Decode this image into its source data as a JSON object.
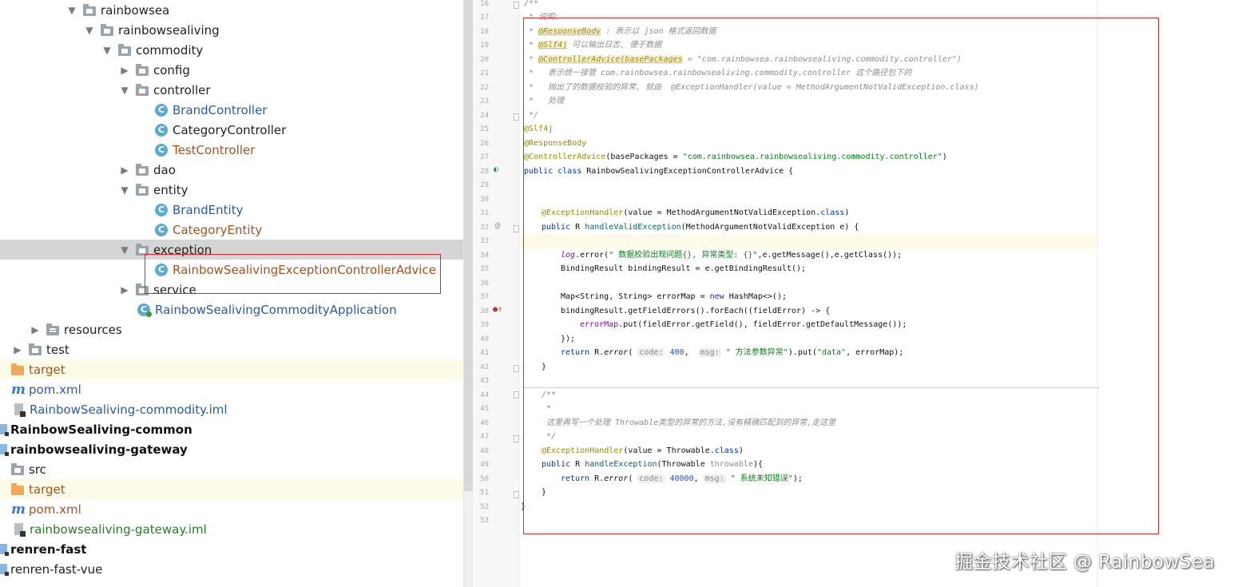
{
  "tree": {
    "items": [
      {
        "label": "rainbowsea",
        "type": "folder",
        "expanded": true
      },
      {
        "label": "rainbowsealiving",
        "type": "folder",
        "expanded": true
      },
      {
        "label": "commodity",
        "type": "folder",
        "expanded": true
      },
      {
        "label": "config",
        "type": "folder",
        "expanded": false
      },
      {
        "label": "controller",
        "type": "folder",
        "expanded": true
      },
      {
        "label": "BrandController",
        "type": "class"
      },
      {
        "label": "CategoryController",
        "type": "class"
      },
      {
        "label": "TestController",
        "type": "class"
      },
      {
        "label": "dao",
        "type": "folder",
        "expanded": false
      },
      {
        "label": "entity",
        "type": "folder",
        "expanded": true
      },
      {
        "label": "BrandEntity",
        "type": "class"
      },
      {
        "label": "CategoryEntity",
        "type": "class"
      },
      {
        "label": "exception",
        "type": "folder",
        "expanded": true
      },
      {
        "label": "RainbowSealivingExceptionControllerAdvice",
        "type": "class"
      },
      {
        "label": "service",
        "type": "folder",
        "expanded": false
      },
      {
        "label": "RainbowSealivingCommodityApplication",
        "type": "app-class"
      },
      {
        "label": "resources",
        "type": "folder",
        "expanded": false
      },
      {
        "label": "test",
        "type": "folder",
        "expanded": false
      },
      {
        "label": "target",
        "type": "folder"
      },
      {
        "label": "pom.xml",
        "type": "maven"
      },
      {
        "label": "RainbowSealiving-commodity.iml",
        "type": "iml"
      },
      {
        "label": "RainbowSealiving-common",
        "type": "module"
      },
      {
        "label": "rainbowsealiving-gateway",
        "type": "module"
      },
      {
        "label": "src",
        "type": "folder"
      },
      {
        "label": "target",
        "type": "folder"
      },
      {
        "label": "pom.xml",
        "type": "maven"
      },
      {
        "label": "rainbowsealiving-gateway.iml",
        "type": "iml"
      },
      {
        "label": "renren-fast",
        "type": "module"
      },
      {
        "label": "renren-fast-vue",
        "type": "module"
      }
    ]
  },
  "editor": {
    "line_numbers": [
      "16",
      "17",
      "18",
      "19",
      "20",
      "21",
      "22",
      "23",
      "24",
      "25",
      "26",
      "27",
      "28",
      "29",
      "30",
      "31",
      "32",
      "33",
      "34",
      "35",
      "36",
      "37",
      "38",
      "39",
      "40",
      "41",
      "42",
      "43",
      "44",
      "45",
      "46",
      "47",
      "48",
      "49",
      "50",
      "51",
      "52",
      "53"
    ],
    "code": {
      "l16": "/**",
      "l17_a": " * ",
      "l17_b": "说明:",
      "l18_a": " * ",
      "l18_b": "@ResponseBody",
      "l18_c": " : 表示以 json 格式返回数据",
      "l19_a": " * ",
      "l19_b": "@Slf4j",
      "l19_c": " 可以输出日志, 便于数据",
      "l20_a": " * ",
      "l20_b": "@ControllerAdvice(basePackages",
      "l20_c": " = \"com.rainbowsea.rainbowsealiving.commodity.controller\")",
      "l21": " *   表示统一接管 com.rainbowsea.rainbowsealiving.commodity.controller 这个路径包下的",
      "l22": " *   抛出了的数据校验的异常, 就由  @ExceptionHandler(value = MethodArgumentNotValidException.class)",
      "l23": " *   处理",
      "l24": " */",
      "l25": "@Slf4j",
      "l26": "@ResponseBody",
      "l27_a": "@ControllerAdvice",
      "l27_b": "(basePackages = ",
      "l27_c": "\"com.rainbowsea.rainbowsealiving.commodity.controller\"",
      "l27_d": ")",
      "l28_a": "public class ",
      "l28_b": "RainbowSealivingExceptionControllerAdvice {",
      "l31_a": "@ExceptionHandler",
      "l31_b": "(value = MethodArgumentNotValidException.",
      "l31_c": "class",
      "l31_d": ")",
      "l32_a": "public ",
      "l32_b": "R ",
      "l32_c": "handleValidException",
      "l32_d": "(MethodArgumentNotValidException e) {",
      "l34_a": "log",
      "l34_b": ".error(",
      "l34_c": "\" 数据校验出现问题{}, 异常类型: {}\"",
      "l34_d": ",e.getMessage(),e.getClass());",
      "l35": "BindingResult bindingResult = e.getBindingResult();",
      "l37_a": "Map<String, String> errorMap = ",
      "l37_b": "new ",
      "l37_c": "HashMap<>();",
      "l38": "bindingResult.getFieldErrors().forEach((fieldError) -> {",
      "l39_a": "errorMap",
      "l39_b": ".put(fieldError.getField(), fieldError.getDefaultMessage());",
      "l40": "});",
      "l41_a": "return ",
      "l41_b": "R.",
      "l41_c": "error",
      "l41_d": "( ",
      "l41_h1": "code:",
      "l41_e": " 400",
      "l41_f": ",  ",
      "l41_h2": "msg:",
      "l41_g": " \" 方法参数异常\"",
      "l41_i": ").put(",
      "l41_j": "\"data\"",
      "l41_k": ", errorMap);",
      "l42": "}",
      "l44": "/**",
      "l45": " *",
      "l46": " 这里再写一个处理 Throwable类型的异常的方法,没有精确匹配到的异常,走这里",
      "l47": " */",
      "l48_a": "@ExceptionHandler",
      "l48_b": "(value = Throwable.",
      "l48_c": "class",
      "l48_d": ")",
      "l49_a": "public ",
      "l49_b": "R ",
      "l49_c": "handleException",
      "l49_d": "(Throwable ",
      "l49_e": "throwable",
      "l49_f": "){",
      "l50_a": "return ",
      "l50_b": "R.",
      "l50_c": "error",
      "l50_d": "( ",
      "l50_h1": "code:",
      "l50_e": " 40000",
      "l50_f": ", ",
      "l50_h2": "msg:",
      "l50_g": " \" 系统未知错误\"",
      "l50_i": ");",
      "l51": "}",
      "l52": "}"
    },
    "gutter_marks": {
      "override": "@",
      "run": "◐",
      "impl": "●↑"
    }
  },
  "watermark": "掘金技术社区 @ RainbowSea"
}
